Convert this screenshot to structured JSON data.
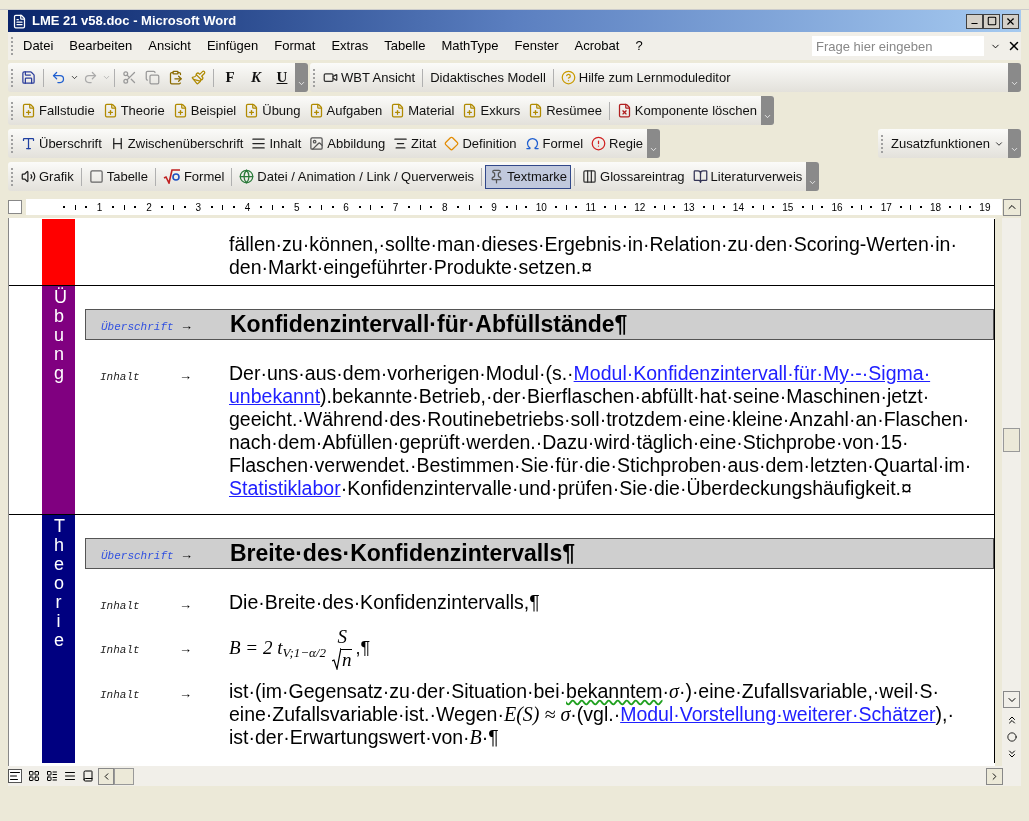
{
  "window": {
    "title": "LME 21 v58.doc - Microsoft Word"
  },
  "menu": {
    "items": [
      "Datei",
      "Bearbeiten",
      "Ansicht",
      "Einfügen",
      "Format",
      "Extras",
      "Tabelle",
      "MathType",
      "Fenster",
      "Acrobat",
      "?"
    ],
    "help_field": {
      "placeholder": "Frage hier eingeben"
    }
  },
  "standard_toolbar": {
    "format_buttons": [
      "F",
      "K",
      "U"
    ]
  },
  "wbt_toolbar": {
    "items": [
      "WBT Ansicht",
      "Didaktisches Modell",
      "Hilfe zum Lernmoduleditor"
    ]
  },
  "component_toolbar": {
    "items": [
      "Fallstudie",
      "Theorie",
      "Beispiel",
      "Übung",
      "Aufgaben",
      "Material",
      "Exkurs",
      "Resümee",
      "Komponente löschen"
    ]
  },
  "style_toolbar": {
    "items": [
      "Überschrift",
      "Zwischenüberschrift",
      "Inhalt",
      "Abbildung",
      "Zitat",
      "Definition",
      "Formel",
      "Regie"
    ]
  },
  "extra_menu": {
    "label": "Zusatzfunktionen"
  },
  "insert_toolbar": {
    "items": [
      {
        "label": "Grafik",
        "selected": false
      },
      {
        "label": "Tabelle",
        "selected": false
      },
      {
        "label": "Formel",
        "selected": false
      },
      {
        "label": "Datei / Animation / Link / Querverweis",
        "selected": false
      },
      {
        "label": "Textmarke",
        "selected": true
      },
      {
        "label": "Glossareintrag",
        "selected": false
      },
      {
        "label": "Literaturverweis",
        "selected": false
      }
    ]
  },
  "ruler": {
    "ticks": [
      "1",
      "2",
      "3",
      "4",
      "5",
      "6",
      "7",
      "8",
      "9",
      "10",
      "11",
      "12",
      "13",
      "14",
      "15",
      "16",
      "17",
      "18",
      "19"
    ]
  },
  "document": {
    "tab_mark": "→",
    "sections": [
      {
        "color": "#ff0000",
        "blocks": [
          {
            "kind": "continuation",
            "lines": [
              "fällen·zu·können,·sollte·man·dieses·Ergebnis·in·Relation·zu·den·Scoring-Werten·in·",
              "den·Markt·eingeführter·Produkte·setzen.¤"
            ]
          }
        ]
      },
      {
        "label": "Übung",
        "color": "#800080",
        "blocks": [
          {
            "kind": "heading",
            "style": "Überschrift",
            "text": "Konfidenzintervall·für·Abfüllstände¶"
          },
          {
            "kind": "paragraph",
            "style": "Inhalt",
            "lines": [
              [
                {
                  "kind": "text",
                  "text": "Der·uns·aus·dem·vorherigen·Modul·(s.·"
                },
                {
                  "kind": "link",
                  "text": "Modul·Konfidenzintervall·für·My·-·Sigma·"
                }
              ],
              [
                {
                  "kind": "link",
                  "text": "unbekannt"
                },
                {
                  "kind": "text",
                  "text": ").bekannte·Betrieb,·der·Bierflaschen·abfüllt·hat·seine·Maschinen·jetzt·"
                }
              ],
              "geeicht.·Während·des·Routinebetriebs·soll·trotzdem·eine·kleine·Anzahl·an·Flaschen·",
              "nach·dem·Abfüllen·geprüft·werden.·Dazu·wird·täglich·eine·Stichprobe·von·15·",
              "Flaschen·verwendet.·Bestimmen·Sie·für·die·Stichproben·aus·dem·letzten·Quartal·im·",
              [
                {
                  "kind": "link",
                  "text": "Statistiklabor"
                },
                {
                  "kind": "text",
                  "text": "·Konfidenzintervalle·und·prüfen·Sie·die·Überdeckungshäufigkeit.¤"
                }
              ]
            ]
          }
        ]
      },
      {
        "label": "Theorie",
        "color": "#000080",
        "blocks": [
          {
            "kind": "heading",
            "style": "Überschrift",
            "text": "Breite·des·Konfidenzintervalls¶"
          },
          {
            "kind": "paragraph",
            "style": "Inhalt",
            "lines": [
              "Die·Breite·des·Konfidenzintervalls,¶"
            ]
          },
          {
            "kind": "formula",
            "style": "Inhalt",
            "lhs": "B = 2",
            "variable": "t",
            "subscript": "V;1−α/2",
            "numerator": "S",
            "denominator": "n",
            "tail": ",¶"
          },
          {
            "kind": "paragraph",
            "style": "Inhalt",
            "lines": [
              [
                {
                  "kind": "text",
                  "text": "ist·(im·Gegensatz·zu·der·Situation·bei·"
                },
                {
                  "kind": "flagged",
                  "text": "bekanntem"
                },
                {
                  "kind": "text",
                  "text": "·"
                },
                {
                  "kind": "math",
                  "text": "σ"
                },
                {
                  "kind": "text",
                  "text": "·)·eine·Zufallsvariable,·weil·S·"
                }
              ],
              [
                {
                  "kind": "text",
                  "text": "eine·Zufallsvariable·ist.·Wegen·"
                },
                {
                  "kind": "math",
                  "text": "E(S) ≈ σ"
                },
                {
                  "kind": "text",
                  "text": "·(vgl.·"
                },
                {
                  "kind": "link",
                  "text": "Modul·Vorstellung·weiterer·Schätzer"
                },
                {
                  "kind": "text",
                  "text": "),·"
                }
              ],
              [
                {
                  "kind": "text",
                  "text": "ist·der·Erwartungswert·von·"
                },
                {
                  "kind": "math",
                  "text": "B"
                },
                {
                  "kind": "text",
                  "text": "·¶"
                }
              ]
            ]
          }
        ]
      }
    ]
  }
}
